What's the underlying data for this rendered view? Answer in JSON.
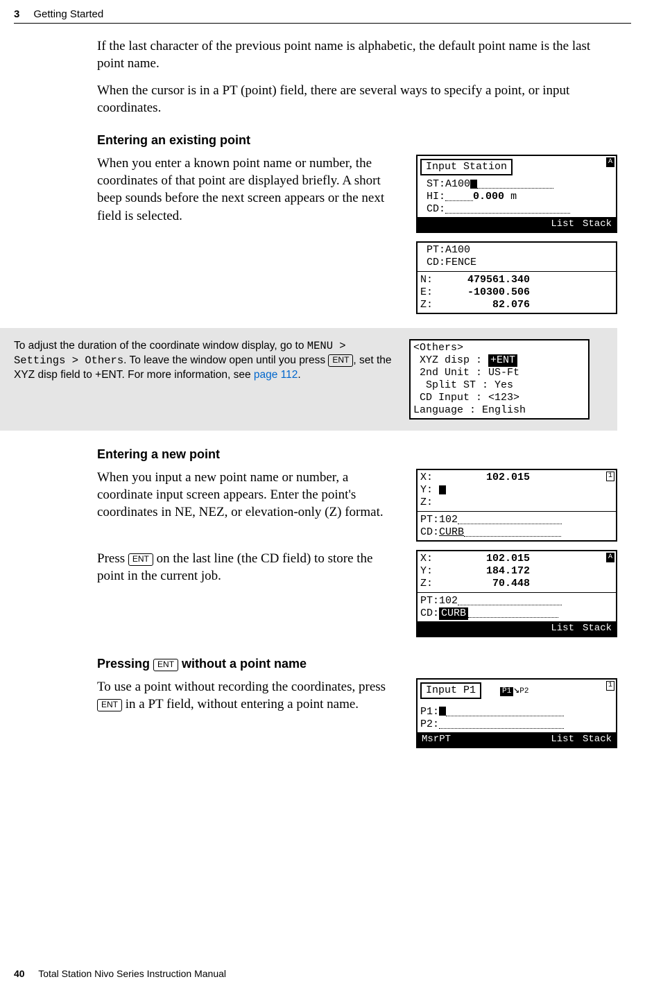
{
  "header": {
    "chapter_number": "3",
    "chapter_title": "Getting Started"
  },
  "intro": {
    "p1": "If the last character of the previous point name is alphabetic, the default point name is the last point name.",
    "p2": "When the cursor is in a PT (point) field, there are several ways to specify a point, or input coordinates."
  },
  "sec_existing": {
    "title": "Entering an existing point",
    "body": "When you enter a known point name or number, the coordinates of that point are displayed briefly. A short beep sounds before the next screen appears or the next field is selected.",
    "lcd1": {
      "title": "Input Station",
      "st_label": "ST:",
      "st_val": "A100",
      "hi_label": "HI:",
      "hi_val": "0.000",
      "hi_unit": "m",
      "cd_label": "CD:",
      "btn_list": "List",
      "btn_stack": "Stack",
      "indicator": "A"
    },
    "lcd2": {
      "pt_label": "PT:",
      "pt_val": "A100",
      "cd_label": "CD:",
      "cd_val": "FENCE",
      "n_label": "N:",
      "n_val": "479561.340",
      "e_label": "E:",
      "e_val": "-10300.506",
      "z_label": "Z:",
      "z_val": "82.076"
    }
  },
  "note": {
    "t1": "To adjust the duration of the coordinate window display, go to ",
    "menu_path": "MENU > Settings > Others",
    "t2": ". To leave the window open until you press ",
    "key_ent": "ENT",
    "t3": ", set the XYZ disp field to +ENT. For more information, see ",
    "link_text": "page 112",
    "t4": ".",
    "lcd": {
      "title": "<Others>",
      "r1_l": "XYZ disp",
      "r1_v": "+ENT",
      "r2_l": "2nd Unit",
      "r2_v": "US-Ft",
      "r3_l": "Split ST",
      "r3_v": "Yes",
      "r4_l": "CD Input",
      "r4_v": "<123>",
      "r5_l": "Language",
      "r5_v": "English"
    }
  },
  "sec_new": {
    "title": "Entering a new point",
    "p1": "When you input a new point name or number, a coordinate input screen appears. Enter the point's coordinates in NE, NEZ, or elevation-only (Z) format.",
    "p2a": "Press ",
    "p2b": " on the last line (the CD field) to store the point in the current job.",
    "key_ent": "ENT",
    "lcd1": {
      "x_label": "X:",
      "x_val": "102.015",
      "y_label": "Y:",
      "z_label": "Z:",
      "pt_label": "PT:",
      "pt_val": "102",
      "cd_label": "CD:",
      "cd_val": "CURB",
      "indicator": "1"
    },
    "lcd2": {
      "x_label": "X:",
      "x_val": "102.015",
      "y_label": "Y:",
      "y_val": "184.172",
      "z_label": "Z:",
      "z_val": "70.448",
      "pt_label": "PT:",
      "pt_val": "102",
      "cd_label": "CD:",
      "cd_val": "CURB",
      "btn_list": "List",
      "btn_stack": "Stack",
      "indicator": "A"
    }
  },
  "sec_noname": {
    "title_a": "Pressing ",
    "title_b": " without a point name",
    "key_ent": "ENT",
    "p1a": "To use a point without recording the coordinates, press ",
    "p1b": " in a PT field, without entering a point name.",
    "lcd": {
      "title": "Input P1",
      "p1_label": "P1:",
      "p2_label": "P2:",
      "btn_msr": "MsrPT",
      "btn_list": "List",
      "btn_stack": "Stack",
      "badge1": "P1",
      "badge2": "P2",
      "indicator": "1"
    }
  },
  "footer": {
    "page_number": "40",
    "manual_title": "Total Station Nivo Series Instruction Manual"
  }
}
